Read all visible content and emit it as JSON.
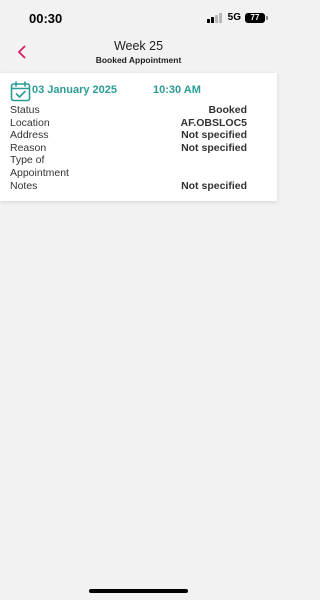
{
  "status_bar": {
    "time": "00:30",
    "network": "5G",
    "battery": "77"
  },
  "header": {
    "title": "Week 25",
    "subtitle": "Booked Appointment",
    "back_icon": "chevron-left-icon",
    "accent": "#d81b6a"
  },
  "appointment": {
    "date": "03 January 2025",
    "time": "10:30 AM",
    "icon": "calendar-check-icon",
    "accent": "#2b9c95",
    "details": [
      {
        "label": "Status",
        "value": "Booked"
      },
      {
        "label": "Location",
        "value": "AF.OBSLOC5"
      },
      {
        "label": "Address",
        "value": "Not specified"
      },
      {
        "label": "Reason",
        "value": "Not specified"
      },
      {
        "label": "Type of Appointment",
        "value": ""
      },
      {
        "label": "Notes",
        "value": "Not specified"
      }
    ]
  }
}
